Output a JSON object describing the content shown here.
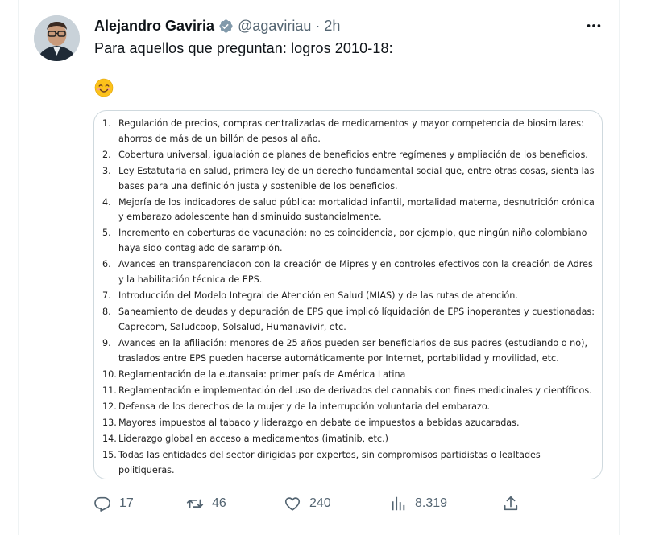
{
  "tweet": {
    "author_name": "Alejandro Gaviria",
    "handle": "@agaviriau",
    "separator": "·",
    "time": "2h",
    "text": "Para aquellos que preguntan: logros 2010-18:"
  },
  "document": {
    "items": [
      {
        "num": "1.",
        "text": "Regulación de precios, compras centralizadas de medicamentos y mayor competencia de biosimilares: ahorros de más de un billón de pesos al año."
      },
      {
        "num": "2.",
        "text": "Cobertura universal, igualación de planes de beneficios entre regímenes y ampliación de los beneficios."
      },
      {
        "num": "3.",
        "text": "Ley Estatutaria en salud, primera ley de un derecho fundamental social que, entre otras cosas, sienta las bases para una definición justa y sostenible de los beneficios."
      },
      {
        "num": "4.",
        "text": "Mejoría de los indicadores de salud pública: mortalidad infantil, mortalidad materna, desnutrición crónica y embarazo adolescente han disminuido sustancialmente."
      },
      {
        "num": "5.",
        "text": "Incremento en coberturas de vacunación: no es coincidencia, por ejemplo, que ningún niño colombiano haya sido contagiado de sarampión."
      },
      {
        "num": "6.",
        "text": " Avances en transparenciacon con la creación de Mipres y en controles efectivos con la creación de Adres y la habilitación técnica de EPS."
      },
      {
        "num": "7.",
        "text": "Introducción del Modelo Integral de Atención en Salud (MIAS) y de las rutas de atención."
      },
      {
        "num": "8.",
        "text": "Saneamiento de deudas y depuración de EPS que implicó líquidación de EPS inoperantes y cuestionadas: Caprecom, Saludcoop, Solsalud, Humanavivir, etc."
      },
      {
        "num": "9.",
        "text": "Avances en la afiliación: menores de 25 años pueden ser beneficiarios de sus padres (estudiando o no), traslados entre EPS pueden hacerse automáticamente por Internet, portabilidad y movilidad, etc."
      },
      {
        "num": "10.",
        "text": "Reglamentación de la eutansaia: primer país de América Latina"
      },
      {
        "num": "11.",
        "text": "Reglamentación e implementación del uso de derivados del cannabis con fines medicinales y científicos."
      },
      {
        "num": "12.",
        "text": "Defensa de los derechos de la mujer y de la interrupción voluntaria del embarazo."
      },
      {
        "num": "13.",
        "text": "Mayores impuestos al tabaco y liderazgo en debate de impuestos a bebidas azucaradas."
      },
      {
        "num": "14.",
        "text": "Liderazgo global en acceso a medicamentos (imatinib, etc.)"
      },
      {
        "num": "15.",
        "text": "Todas las entidades del sector dirigidas por expertos, sin compromisos partidistas o lealtades politiqueras."
      }
    ]
  },
  "actions": {
    "replies": "17",
    "retweets": "46",
    "likes": "240",
    "views": "8.319"
  },
  "icons": {
    "verified": "verified-badge-icon",
    "more": "more-dots-icon",
    "emoji": "smiling-face-emoji",
    "reply": "reply-icon",
    "retweet": "retweet-icon",
    "like": "heart-icon",
    "views": "views-chart-icon",
    "share": "share-icon"
  },
  "colors": {
    "text_primary": "#0f1419",
    "text_secondary": "#536471",
    "verified": "#829aab",
    "border": "#cfd9de"
  }
}
